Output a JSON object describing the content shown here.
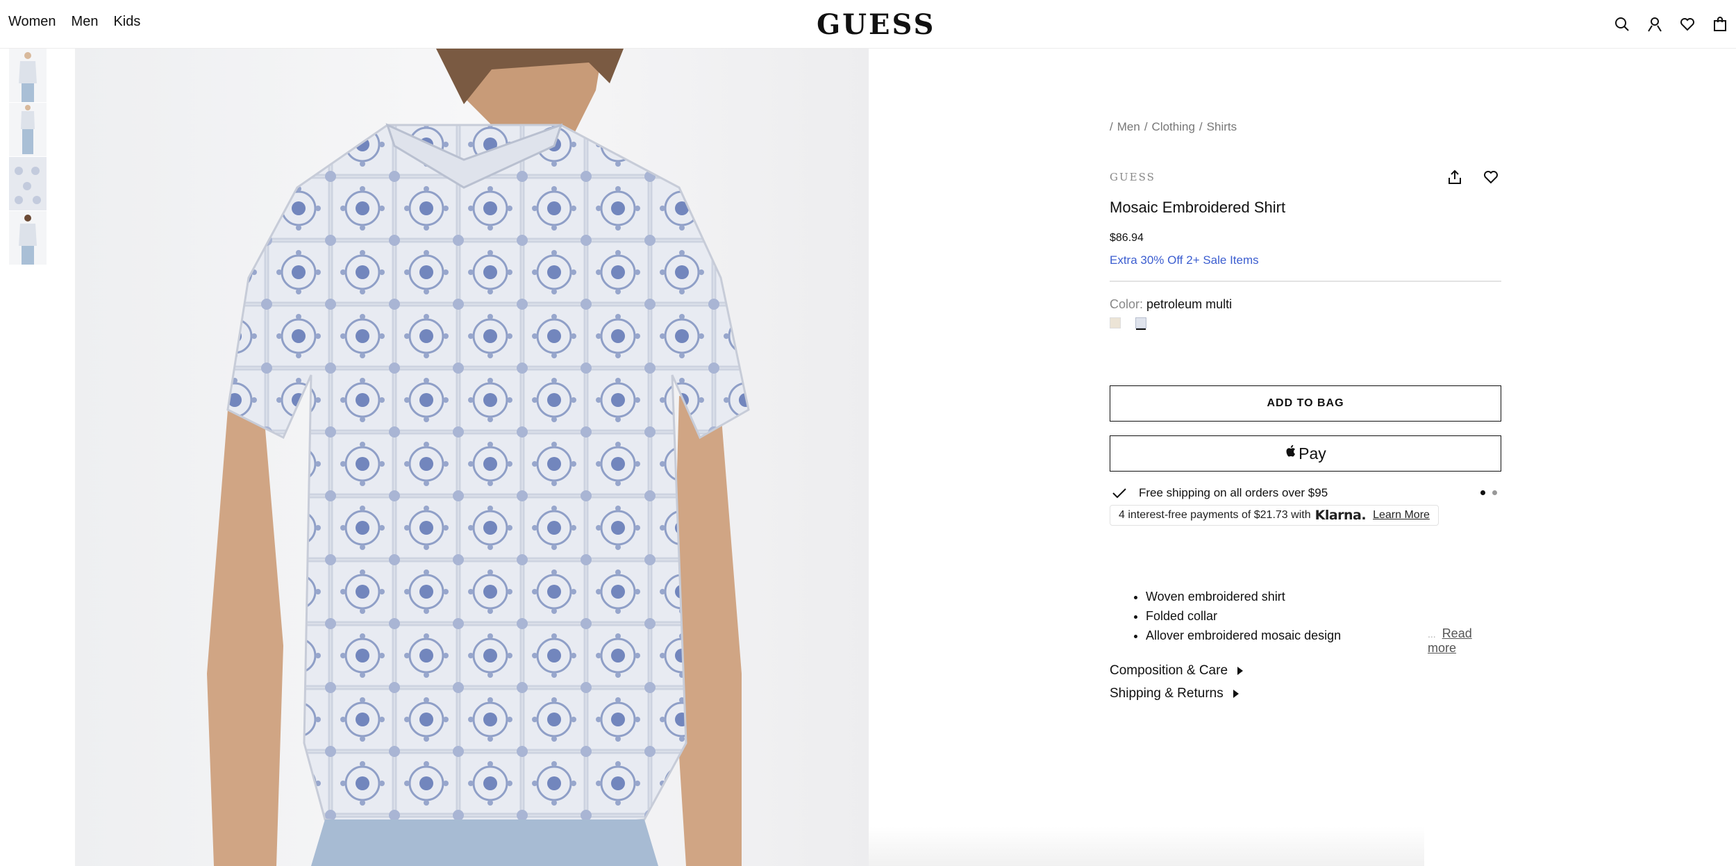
{
  "header": {
    "nav": [
      "Women",
      "Men",
      "Kids"
    ],
    "logo": "GUESS",
    "icons": [
      "search-icon",
      "account-icon",
      "wishlist-icon",
      "bag-icon"
    ]
  },
  "gallery": {
    "thumbnails": [
      "shirt-front-thumbnail",
      "shirt-full-thumbnail",
      "shirt-detail-thumbnail",
      "shirt-back-thumbnail"
    ],
    "main_image": "shirt-back-view"
  },
  "product": {
    "breadcrumb": [
      "/",
      "Men",
      "/",
      "Clothing",
      "/",
      "Shirts"
    ],
    "brand": "GUESS",
    "title": "Mosaic Embroidered Shirt",
    "price": "$86.94",
    "promo": "Extra 30% Off 2+ Sale Items",
    "color_label": "Color:",
    "color_value": "petroleum multi",
    "swatch_colors": [
      "#ece4d6",
      "#dfe3ec"
    ],
    "add_to_bag": "ADD TO BAG",
    "apple_pay": "Pay",
    "shipping_text": "Free shipping on all orders over $95",
    "klarna_text": "4 interest-free payments of $21.73 with",
    "klarna_brand": "Klarna.",
    "klarna_link": "Learn More",
    "features": [
      "Woven embroidered shirt",
      "Folded collar",
      "Allover embroidered mosaic design"
    ],
    "ellipsis": "...",
    "read_more": "Read more",
    "accordions": [
      "Composition & Care",
      "Shipping & Returns"
    ]
  },
  "colors": {
    "promo": "#3c5ed0",
    "text": "#111111",
    "muted": "#777777"
  }
}
